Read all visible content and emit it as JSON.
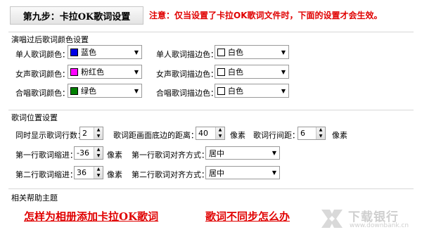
{
  "header": {
    "step_title": "第九步：卡拉OK歌词设置",
    "notice": "注意：仅当设置了卡拉OK歌词文件时，下面的设置才会生效。"
  },
  "colors_group": {
    "title": "演唱过后歌词颜色设置",
    "rows": [
      {
        "label": "单人歌词颜色：",
        "color_name": "蓝色",
        "color": "#0000e6",
        "outline_label": "单人歌词描边色：",
        "outline_name": "白色",
        "outline_color": "#ffffff"
      },
      {
        "label": "女声歌词颜色：",
        "color_name": "粉红色",
        "color": "#ff00ff",
        "outline_label": "女声歌词描边色：",
        "outline_name": "白色",
        "outline_color": "#ffffff"
      },
      {
        "label": "合唱歌词颜色：",
        "color_name": "绿色",
        "color": "#008000",
        "outline_label": "合唱歌词描边色：",
        "outline_name": "白色",
        "outline_color": "#ffffff"
      }
    ]
  },
  "position_group": {
    "title": "歌词位置设置",
    "lines_label": "同时显示歌词行数：",
    "lines_value": "2",
    "bottom_label": "歌词距画面底边的距离：",
    "bottom_value": "40",
    "unit": "像素",
    "spacing_label": "歌词行间距：",
    "spacing_value": "6",
    "line1_indent_label": "第一行歌词缩进：",
    "line1_indent_value": "-36",
    "line1_align_label": "第一行歌词对齐方式：",
    "line1_align_value": "居中",
    "line2_indent_label": "第二行歌词缩进：",
    "line2_indent_value": "36",
    "line2_align_label": "第二行歌词对齐方式：",
    "line2_align_value": "居中"
  },
  "help_group": {
    "title": "相关帮助主题",
    "links": [
      "怎样为相册添加卡拉OK歌词",
      "歌词不同步怎么办"
    ]
  },
  "watermark": {
    "name": "下载银行",
    "url": "www.downbank.cn"
  }
}
